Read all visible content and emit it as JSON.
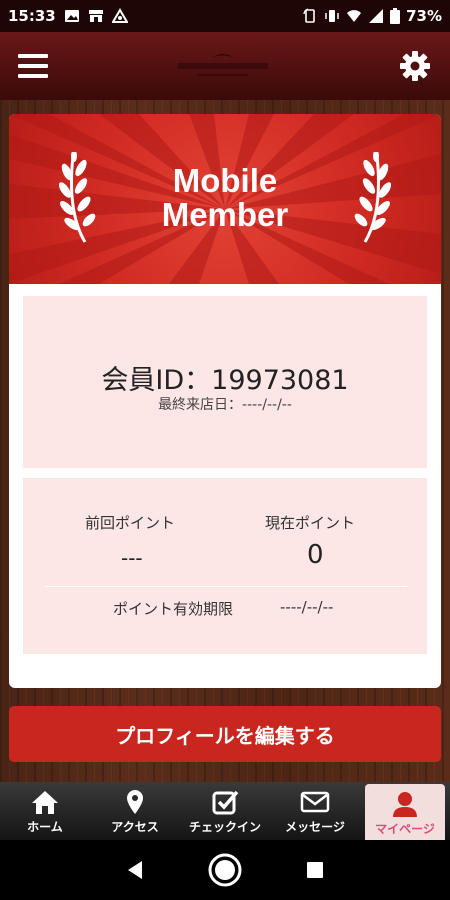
{
  "status_bar": {
    "time": "15:33",
    "battery": "73%",
    "icons": [
      "image-icon",
      "store-icon",
      "triangle-icon",
      "rotate-icon",
      "vibrate-icon",
      "wifi-icon",
      "signal-icon",
      "battery-icon"
    ]
  },
  "header": {
    "menu_icon": "hamburger-icon",
    "settings_icon": "gear-icon"
  },
  "banner": {
    "line1": "Mobile",
    "line2": "Member",
    "background_color": "#cf2a22"
  },
  "member": {
    "id_label": "会員ID：19973081",
    "last_visit": "最終来店日：----/--/--"
  },
  "points": {
    "previous_label": "前回ポイント",
    "previous_value": "---",
    "current_label": "現在ポイント",
    "current_value": "0",
    "expiry_label": "ポイント有効期限",
    "expiry_value": "----/--/--"
  },
  "actions": {
    "edit_profile": "プロフィールを編集する",
    "button_color": "#c8261f"
  },
  "tabs": [
    {
      "label": "ホーム",
      "icon": "home-icon"
    },
    {
      "label": "アクセス",
      "icon": "map-pin-icon"
    },
    {
      "label": "チェックイン",
      "icon": "checkbox-icon"
    },
    {
      "label": "メッセージ",
      "icon": "envelope-icon"
    },
    {
      "label": "マイページ",
      "icon": "user-icon",
      "active": true
    }
  ],
  "colors": {
    "accent": "#c8261f",
    "panel": "#fde6e6",
    "active_tab_text": "#d94b78"
  }
}
